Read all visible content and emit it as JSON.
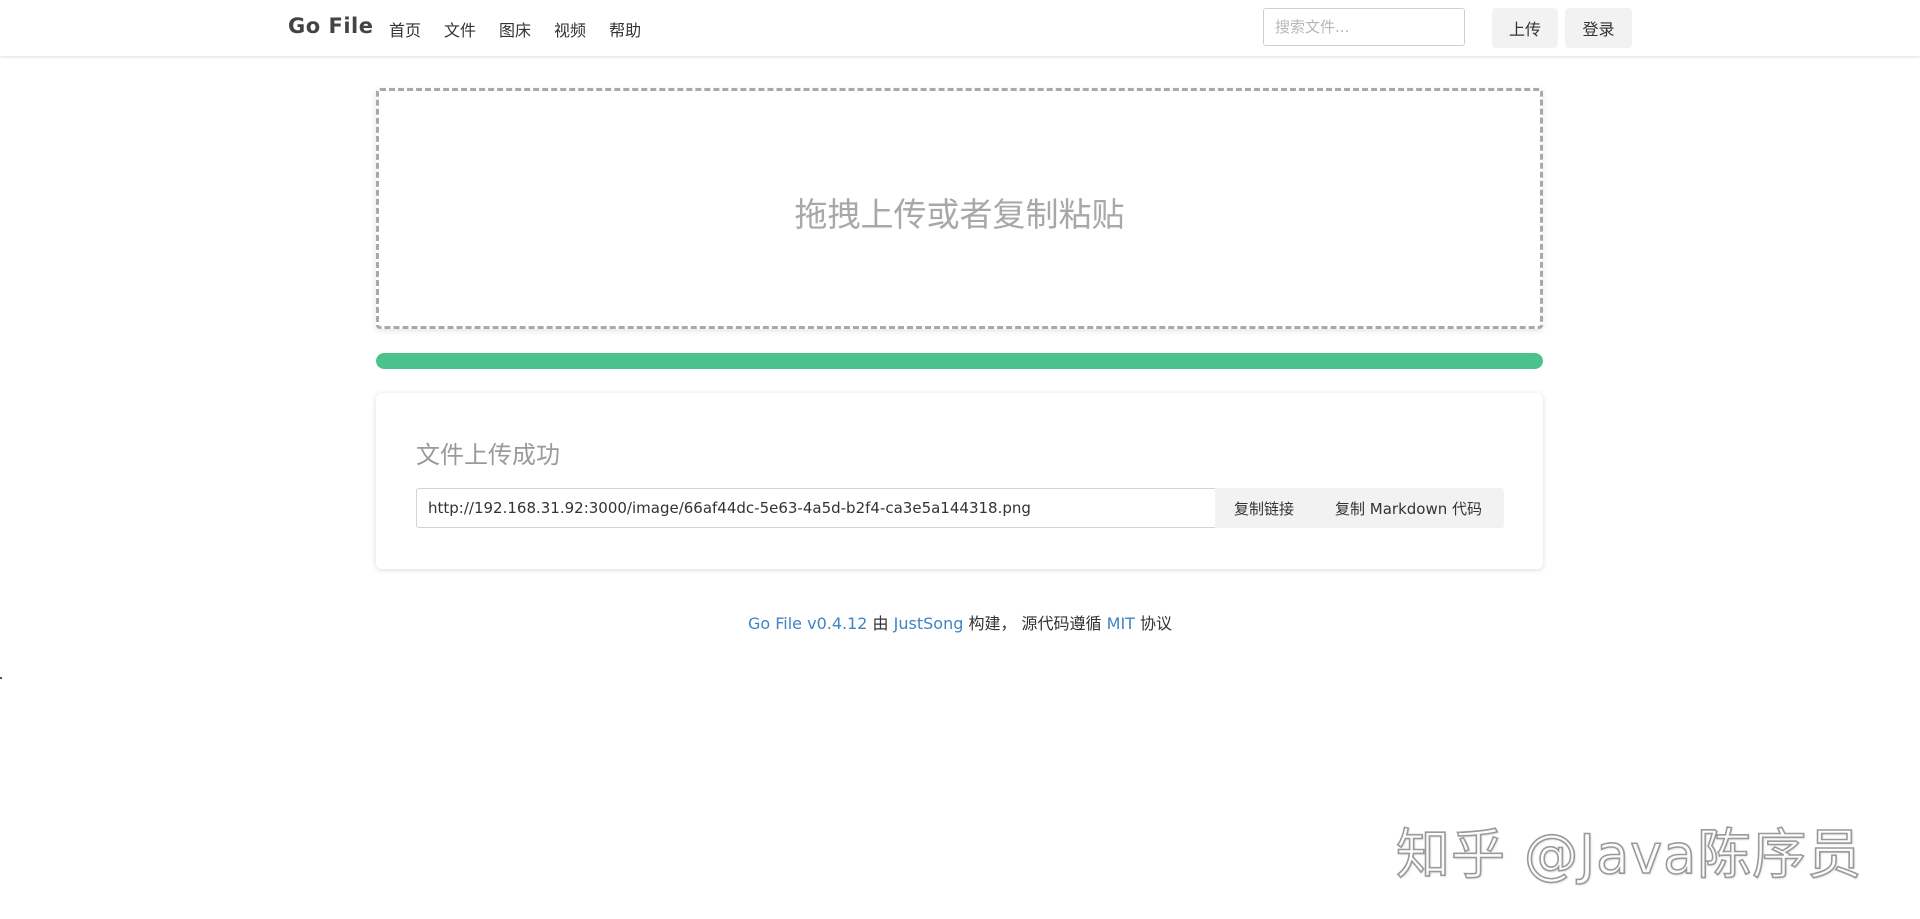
{
  "navbar": {
    "brand": "Go File",
    "menu": [
      {
        "label": "首页"
      },
      {
        "label": "文件"
      },
      {
        "label": "图床"
      },
      {
        "label": "视频"
      },
      {
        "label": "帮助"
      }
    ],
    "search": {
      "placeholder": "搜索文件...",
      "value": ""
    },
    "upload_label": "上传",
    "login_label": "登录"
  },
  "drop_zone": {
    "label": "拖拽上传或者复制粘贴"
  },
  "progress": {
    "percent": 100,
    "color": "#4bc18c"
  },
  "result": {
    "title": "文件上传成功",
    "url": "http://192.168.31.92:3000/image/66af44dc-5e63-4a5d-b2f4-ca3e5a144318.png",
    "copy_link_label": "复制链接",
    "copy_markdown_label": "复制 Markdown 代码"
  },
  "footer": {
    "product": "Go File v0.4.12",
    "by": " 由 ",
    "author": "JustSong",
    "built": " 构建， 源代码遵循 ",
    "license": "MIT",
    "agreement": " 协议"
  },
  "watermark": {
    "text": "知乎 @Java陈序员"
  },
  "colors": {
    "accent": "#4bc18c",
    "link": "#4183c4",
    "button_bg": "#f2f2f2"
  }
}
